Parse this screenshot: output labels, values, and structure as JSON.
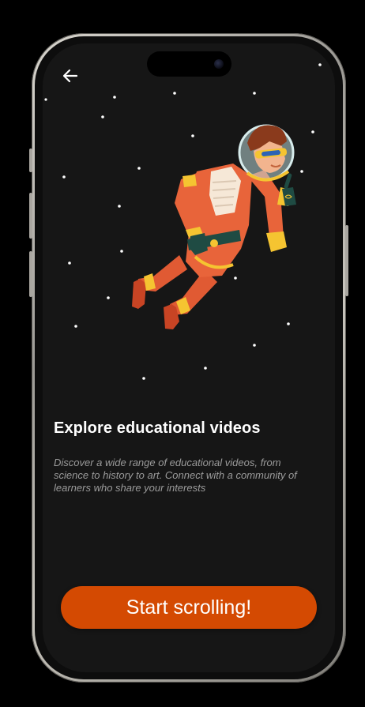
{
  "screen": {
    "back_icon": "arrow-left-icon",
    "illustration": "astronaut-floating",
    "title": "Explore educational videos",
    "description": "Discover a wide range of educational videos, from science to history to art. Connect with a community of learners  who share your interests",
    "cta_label": "Start scrolling!"
  },
  "colors": {
    "background": "#161616",
    "accent": "#d44a02",
    "text_primary": "#ffffff",
    "text_secondary": "#9b9b9b"
  }
}
